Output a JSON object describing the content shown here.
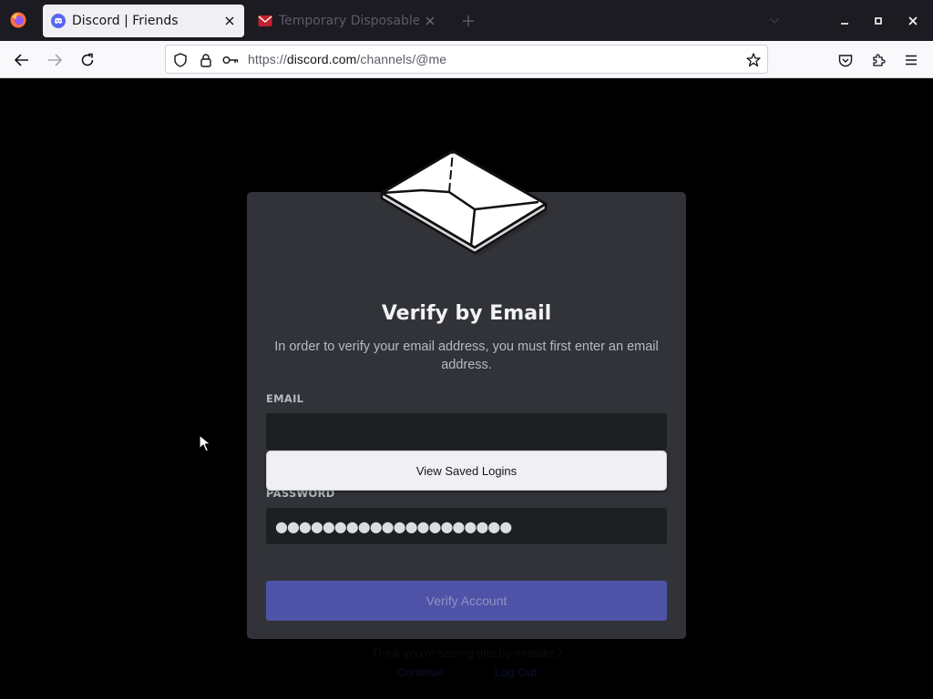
{
  "browser": {
    "tabs": [
      {
        "title": "Discord | Friends",
        "active": true,
        "icon": "discord-icon"
      },
      {
        "title": "Temporary Disposable E",
        "active": false,
        "icon": "temp-mail-icon"
      }
    ],
    "url": {
      "scheme": "https://",
      "domain": "discord.com",
      "path": "/channels/@me"
    }
  },
  "verify": {
    "title": "Verify by Email",
    "subtitle": "In order to verify your email address, you must first enter an email address.",
    "email_label": "EMAIL",
    "email_value": "",
    "password_label": "PASSWORD",
    "password_mask": "●●●●●●●●●●●●●●●●●●●●",
    "button_label": "Verify Account"
  },
  "autocomplete": {
    "saved_logins_label": "View Saved Logins"
  },
  "background": {
    "question": "Think you're seeing this by mistake?",
    "links": [
      "Continue",
      "Log Out"
    ]
  },
  "colors": {
    "card": "#313338",
    "input": "#1e1f22",
    "button": "#4e53a8",
    "accent": "#5865f2"
  }
}
